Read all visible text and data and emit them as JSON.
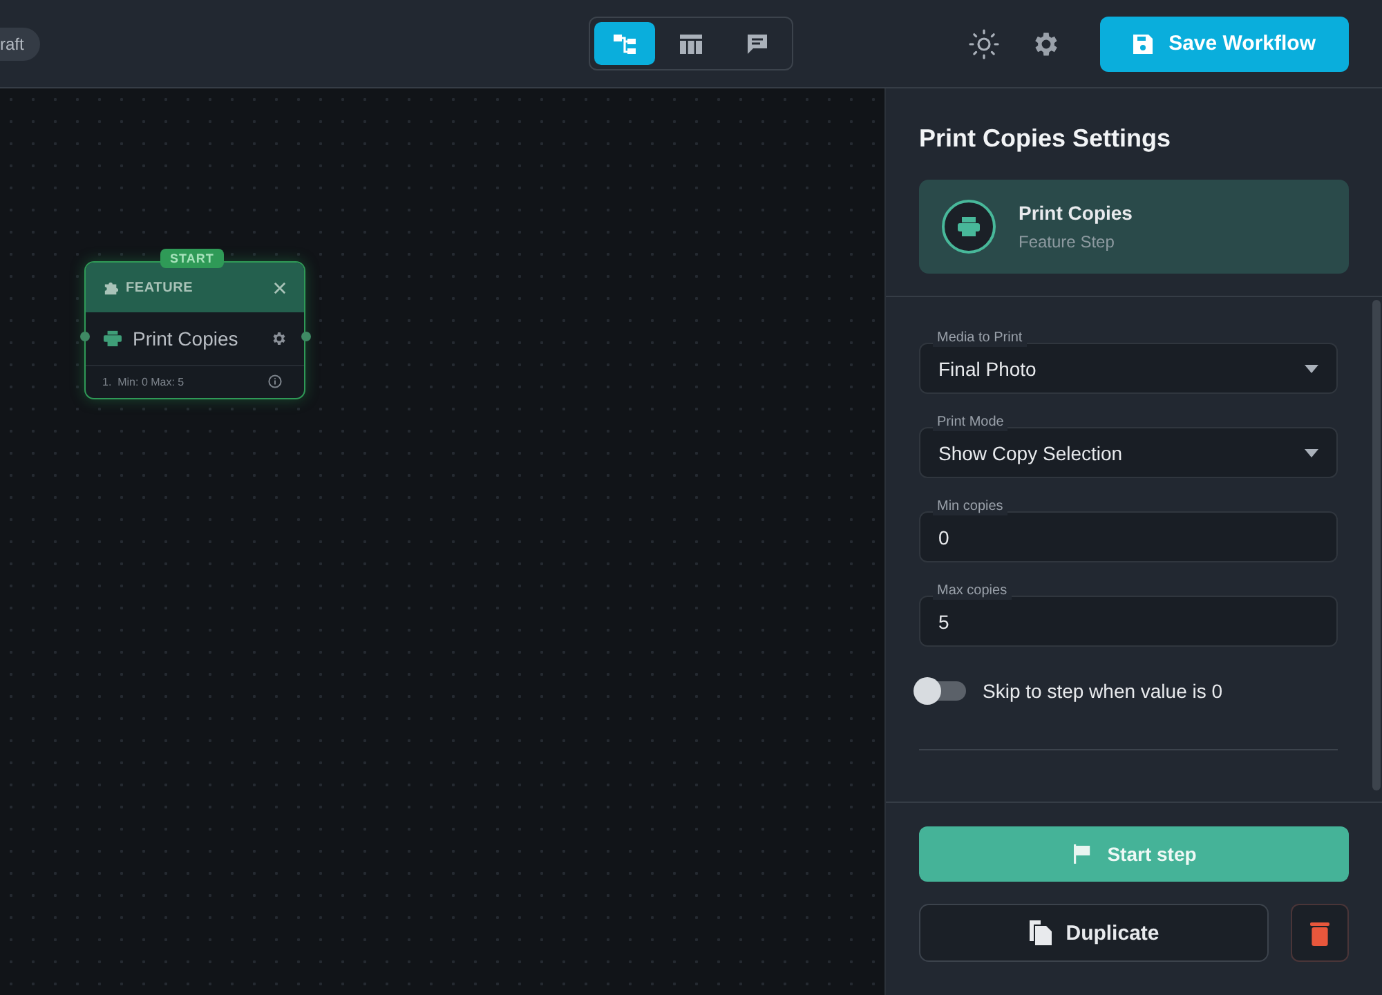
{
  "header": {
    "status_badge": "raft",
    "view_tabs": [
      {
        "selected": true
      },
      {
        "selected": false
      },
      {
        "selected": false
      }
    ],
    "save_button": "Save Workflow"
  },
  "canvas": {
    "node": {
      "start_badge": "START",
      "type": "FEATURE",
      "title": "Print Copies",
      "footer": "1.  Min: 0 Max: 5"
    }
  },
  "panel": {
    "title": "Print Copies Settings",
    "step_card": {
      "name": "Print Copies",
      "subtitle": "Feature Step"
    },
    "fields": [
      {
        "kind": "select",
        "label": "Media to Print",
        "value": "Final Photo"
      },
      {
        "kind": "select",
        "label": "Print Mode",
        "value": "Show Copy Selection"
      },
      {
        "kind": "input",
        "label": "Min copies",
        "value": "0"
      },
      {
        "kind": "input",
        "label": "Max copies",
        "value": "5"
      }
    ],
    "toggle": {
      "label": "Skip to step when value is 0",
      "on": false
    },
    "start_button": "Start step",
    "duplicate_button": "Duplicate"
  }
}
